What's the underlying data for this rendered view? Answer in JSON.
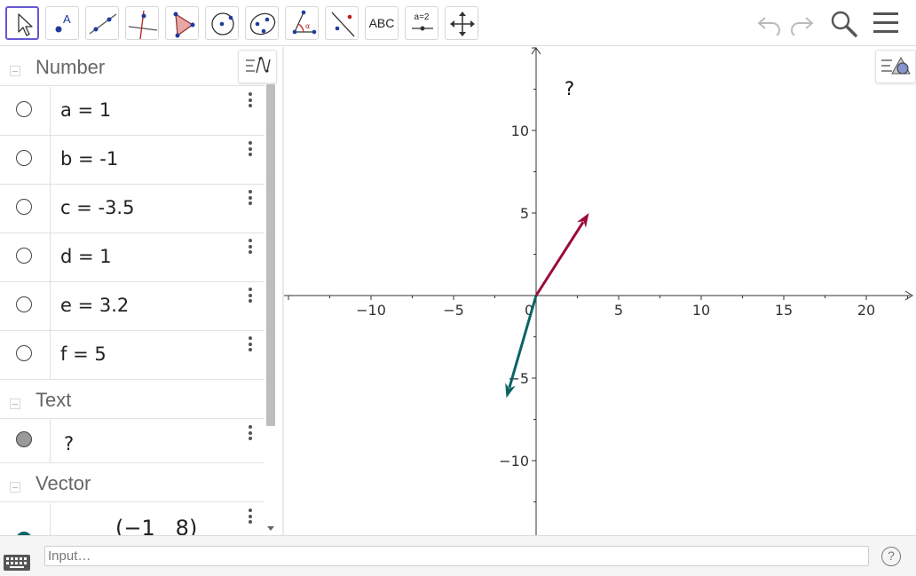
{
  "toolbar": {
    "tools": [
      {
        "name": "move-tool",
        "selected": true
      },
      {
        "name": "point-tool"
      },
      {
        "name": "line-tool"
      },
      {
        "name": "perpendicular-line-tool"
      },
      {
        "name": "polygon-tool"
      },
      {
        "name": "circle-center-point-tool"
      },
      {
        "name": "conic-tool"
      },
      {
        "name": "angle-tool"
      },
      {
        "name": "reflect-tool"
      },
      {
        "name": "text-tool",
        "label": "ABC"
      },
      {
        "name": "slider-tool",
        "label": "a=2"
      },
      {
        "name": "move-graphics-view-tool"
      }
    ],
    "right_icons": [
      "undo-icon",
      "redo-icon",
      "search-icon",
      "menu-icon"
    ]
  },
  "algebra": {
    "groups": [
      {
        "label": "Number"
      },
      {
        "label": "Text"
      },
      {
        "label": "Vector"
      }
    ],
    "numbers": [
      {
        "formula": "a = 1"
      },
      {
        "formula": "b = -1"
      },
      {
        "formula": "c = -3.5"
      },
      {
        "formula": "d = 1"
      },
      {
        "formula": "e = 3.2"
      },
      {
        "formula": "f = 5"
      }
    ],
    "text_items": [
      {
        "formula": "?"
      }
    ],
    "vector_preview": {
      "left": "−1",
      "right": "8"
    }
  },
  "graphics": {
    "text_object": "?",
    "x_ticks": [
      "−10",
      "−5",
      "0",
      "5",
      "10",
      "15",
      "20"
    ],
    "y_ticks": [
      "10",
      "5",
      "−5",
      "−10"
    ],
    "vectors": [
      {
        "name": "vector-u",
        "color": "#9b0a3a",
        "from": [
          0,
          0
        ],
        "to": [
          3.2,
          5
        ]
      },
      {
        "name": "vector-v",
        "color": "#0b6364",
        "from": [
          0,
          0
        ],
        "to": [
          -1.8,
          -6.2
        ]
      }
    ]
  },
  "inputbar": {
    "placeholder": "Input…",
    "help_label": "?"
  },
  "colors": {
    "selected_tool": "#6557d2",
    "vector_u": "#9b0a3a",
    "vector_v": "#0b6364"
  }
}
